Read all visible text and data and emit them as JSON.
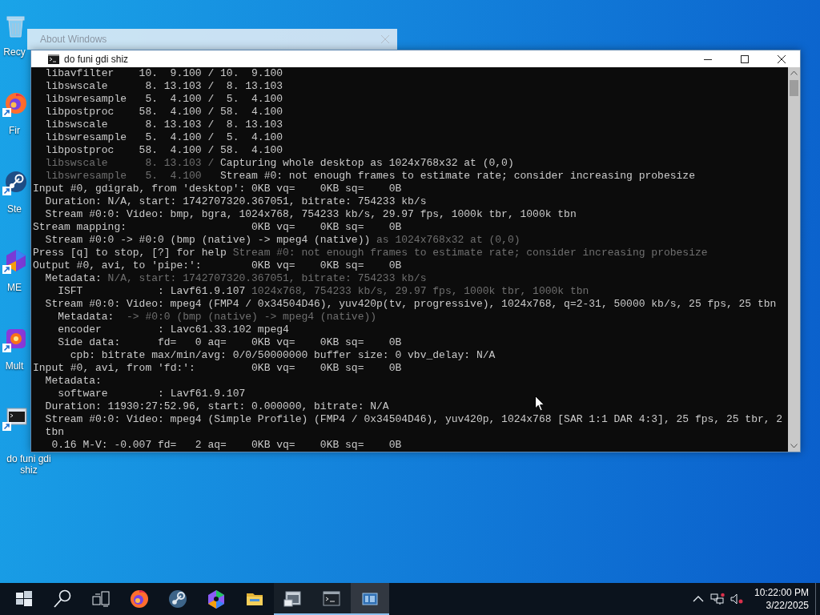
{
  "background_window": {
    "title": "About Windows"
  },
  "console_window": {
    "title": "do funi gdi shiz",
    "lines": [
      {
        "segments": [
          {
            "kind": "text",
            "text": "  libavfilter    10.  9.100 / 10.  9.100"
          }
        ]
      },
      {
        "segments": [
          {
            "kind": "text",
            "text": "  libswscale      8. 13.103 /  8. 13.103"
          }
        ]
      },
      {
        "segments": [
          {
            "kind": "text",
            "text": "  libswresample   5.  4.100 /  5.  4.100"
          }
        ]
      },
      {
        "segments": [
          {
            "kind": "text",
            "text": "  libpostproc    58.  4.100 / 58.  4.100"
          }
        ]
      },
      {
        "segments": [
          {
            "kind": "text",
            "text": "  libswscale      8. 13.103 /  8. 13.103"
          }
        ]
      },
      {
        "segments": [
          {
            "kind": "text",
            "text": "  libswresample   5.  4.100 /  5.  4.100"
          }
        ]
      },
      {
        "segments": [
          {
            "kind": "text",
            "text": "  libpostproc    58.  4.100 / 58.  4.100"
          }
        ]
      },
      {
        "segments": [
          {
            "kind": "ghost",
            "text": "  libswscale      8. 13.103 /"
          },
          {
            "kind": "text",
            "text": " Capturing whole desktop as 1024x768x32 at (0,0)"
          }
        ]
      },
      {
        "segments": [
          {
            "kind": "ghost",
            "text": "  libswresample   5.  4.100"
          },
          {
            "kind": "text",
            "text": "   Stream #0: not enough frames to estimate rate; consider increasing probesize"
          }
        ]
      },
      {
        "segments": [
          {
            "kind": "text",
            "text": "Input #0, gdigrab, from 'desktop':"
          },
          {
            "kind": "text",
            "text": " 0KB vq=    0KB sq=    0B"
          }
        ]
      },
      {
        "segments": [
          {
            "kind": "text",
            "text": "  Duration: N/A, start: 1742707320.367051, bitrate: 754233 kb/s"
          }
        ]
      },
      {
        "segments": [
          {
            "kind": "text",
            "text": "  Stream #0:0: Video: bmp, bgra, 1024x768, 754233 kb/s, 29.97 fps, 1000k tbr, 1000k tbn"
          }
        ]
      },
      {
        "segments": [
          {
            "kind": "text",
            "text": "Stream mapping:"
          },
          {
            "kind": "text",
            "text": "                    0KB vq=    0KB sq=    0B"
          }
        ]
      },
      {
        "segments": [
          {
            "kind": "text",
            "text": "  Stream #0:0 -> #0:0 (bmp (native) -> mpeg4 (native))"
          },
          {
            "kind": "ghost",
            "text": " as 1024x768x32 at (0,0)"
          }
        ]
      },
      {
        "segments": [
          {
            "kind": "text",
            "text": "Press [q] to stop, [?] for help"
          },
          {
            "kind": "ghost",
            "text": " Stream #0: not enough frames to estimate rate; consider increasing probesize"
          }
        ]
      },
      {
        "segments": [
          {
            "kind": "text",
            "text": "Output #0, avi, to 'pipe:':"
          },
          {
            "kind": "text",
            "text": "        0KB vq=    0KB sq=    0B"
          }
        ]
      },
      {
        "segments": [
          {
            "kind": "text",
            "text": "  Metadata:"
          },
          {
            "kind": "ghost",
            "text": " N/A, start: 1742707320.367051, bitrate: 754233 kb/s"
          }
        ]
      },
      {
        "segments": [
          {
            "kind": "text",
            "text": "    ISFT            : Lavf61.9.107"
          },
          {
            "kind": "ghost",
            "text": " 1024x768, 754233 kb/s, 29.97 fps, 1000k tbr, 1000k tbn"
          }
        ]
      },
      {
        "segments": [
          {
            "kind": "text",
            "text": "  Stream #0:0: Video: mpeg4 (FMP4 / 0x34504D46), yuv420p(tv, progressive), 1024x768, q=2-31, 50000 kb/s, 25 fps, 25 tbn"
          }
        ]
      },
      {
        "segments": [
          {
            "kind": "text",
            "text": "    Metadata:"
          },
          {
            "kind": "ghost",
            "text": "  -> #0:0 (bmp (native) -> mpeg4 (native))"
          }
        ]
      },
      {
        "segments": [
          {
            "kind": "text",
            "text": "    encoder         : Lavc61.33.102 mpeg4"
          }
        ]
      },
      {
        "segments": [
          {
            "kind": "text",
            "text": "    Side data:"
          },
          {
            "kind": "text",
            "text": "      fd=   0 aq=    0KB vq=    0KB sq=    0B"
          }
        ]
      },
      {
        "segments": [
          {
            "kind": "text",
            "text": "      cpb: bitrate max/min/avg: 0/0/50000000 buffer size: 0 vbv_delay: N/A"
          }
        ]
      },
      {
        "segments": [
          {
            "kind": "text",
            "text": "Input #0, avi, from 'fd:':"
          },
          {
            "kind": "text",
            "text": "         0KB vq=    0KB sq=    0B"
          }
        ]
      },
      {
        "segments": [
          {
            "kind": "text",
            "text": "  Metadata:"
          }
        ]
      },
      {
        "segments": [
          {
            "kind": "text",
            "text": "    software        : Lavf61.9.107"
          }
        ]
      },
      {
        "segments": [
          {
            "kind": "text",
            "text": "  Duration: 11930:27:52.96, start: 0.000000, bitrate: N/A"
          }
        ]
      },
      {
        "segments": [
          {
            "kind": "text",
            "text": "  Stream #0:0: Video: mpeg4 (Simple Profile) (FMP4 / 0x34504D46), yuv420p, 1024x768 [SAR 1:1 DAR 4:3], 25 fps, 25 tbr, 2"
          }
        ]
      },
      {
        "segments": [
          {
            "kind": "text",
            "text": "  tbn"
          }
        ]
      },
      {
        "segments": [
          {
            "kind": "text",
            "text": "   0.16 M-V: -0.007 fd=   2 aq=    0KB vq=    0KB sq=    0B"
          }
        ]
      }
    ]
  },
  "desktop": {
    "icons": [
      {
        "label": "Recy"
      },
      {
        "label": "Fir"
      },
      {
        "label": "Ste"
      },
      {
        "label": "ME"
      },
      {
        "label": "Mult"
      },
      {
        "label": "do funi gdi shiz"
      }
    ]
  },
  "taskbar": {
    "apps": [
      {
        "open": false,
        "selected": false
      },
      {
        "open": false,
        "selected": false
      },
      {
        "open": false,
        "selected": false
      },
      {
        "open": false,
        "selected": false
      },
      {
        "open": true,
        "selected": false
      },
      {
        "open": true,
        "selected": false
      },
      {
        "open": true,
        "selected": true
      }
    ],
    "clock": {
      "time": "10:22:00 PM",
      "date": "3/22/2025"
    }
  }
}
